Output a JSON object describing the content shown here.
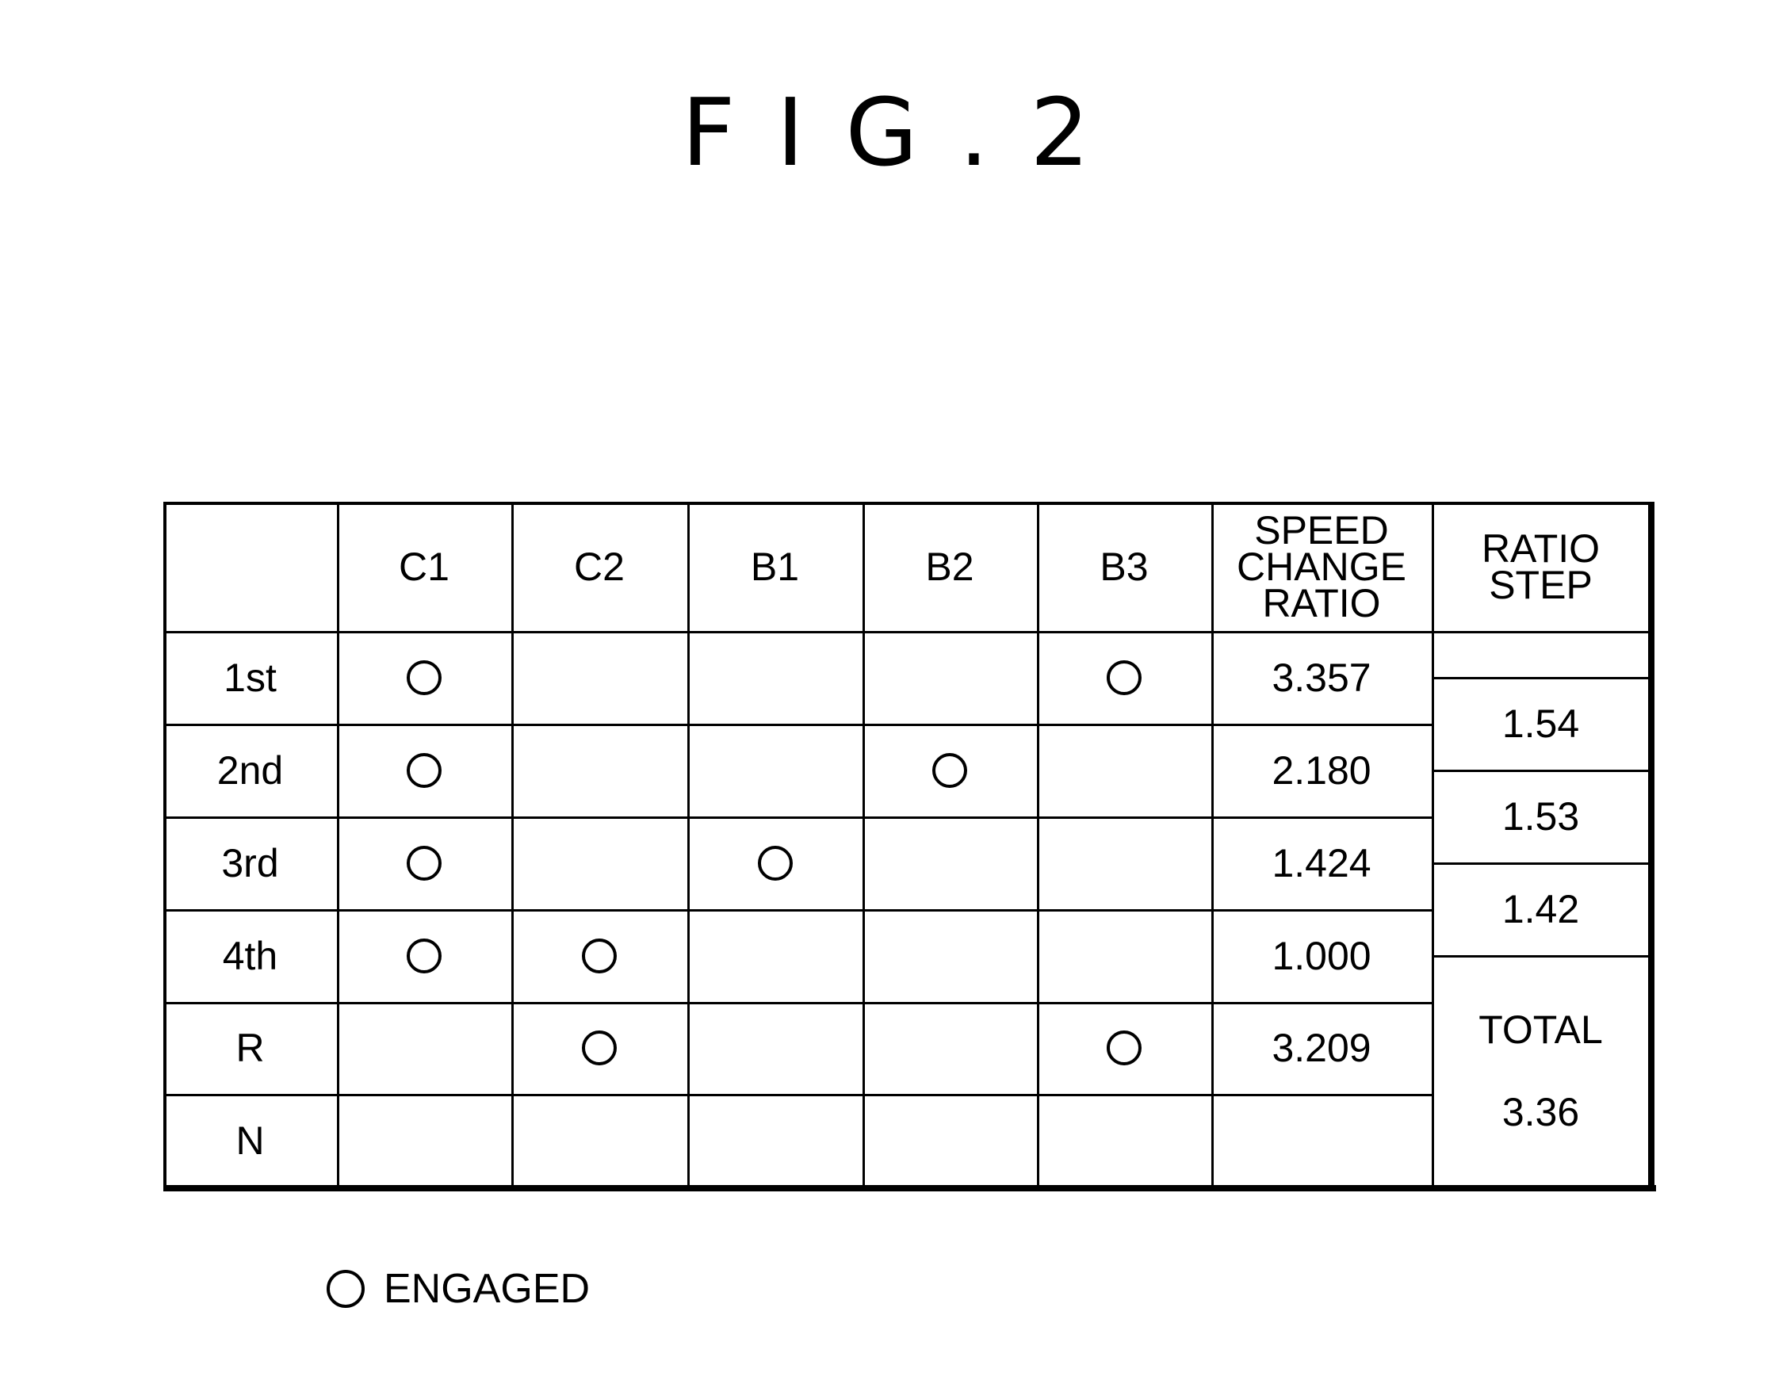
{
  "figure": {
    "title": "FIG.2"
  },
  "table": {
    "corner": "",
    "columns": [
      "C1",
      "C2",
      "B1",
      "B2",
      "B3"
    ],
    "speed_ratio_header": [
      "SPEED",
      "CHANGE",
      "RATIO"
    ],
    "ratio_step_header": [
      "RATIO",
      "STEP"
    ],
    "rows": [
      {
        "label": "1st",
        "engaged": [
          "C1",
          "B3"
        ],
        "speed_ratio": "3.357"
      },
      {
        "label": "2nd",
        "engaged": [
          "C1",
          "B2"
        ],
        "speed_ratio": "2.180"
      },
      {
        "label": "3rd",
        "engaged": [
          "C1",
          "B1"
        ],
        "speed_ratio": "1.424"
      },
      {
        "label": "4th",
        "engaged": [
          "C1",
          "C2"
        ],
        "speed_ratio": "1.000"
      },
      {
        "label": "R",
        "engaged": [
          "C2",
          "B3"
        ],
        "speed_ratio": "3.209"
      },
      {
        "label": "N",
        "engaged": [],
        "speed_ratio": ""
      }
    ],
    "ratio_steps": [
      "1.54",
      "1.53",
      "1.42"
    ],
    "total_label": "TOTAL",
    "total_value": "3.36"
  },
  "legend": {
    "symbol": "circle",
    "label": "ENGAGED"
  }
}
